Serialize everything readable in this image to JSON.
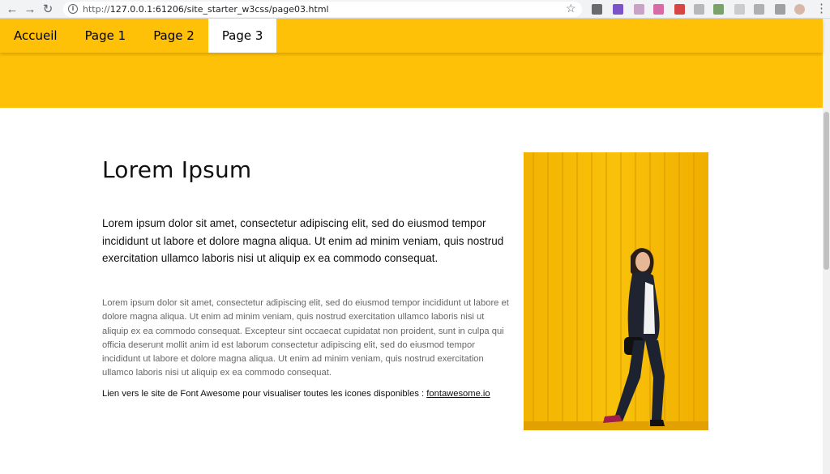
{
  "browser": {
    "url_protocol": "http://",
    "url_rest": "127.0.0.1:61206/site_starter_w3css/page03.html",
    "back_icon": "arrow-left",
    "forward_icon": "arrow-right",
    "reload_icon": "reload",
    "star_icon": "star",
    "menu_icon": "three-dots-vertical"
  },
  "nav": {
    "items": [
      {
        "label": "Accueil"
      },
      {
        "label": "Page 1"
      },
      {
        "label": "Page 2"
      },
      {
        "label": "Page 3",
        "active": true
      }
    ]
  },
  "main": {
    "title": "Lorem Ipsum",
    "lead": "Lorem ipsum dolor sit amet, consectetur adipiscing elit, sed do eiusmod tempor incididunt ut labore et dolore magna aliqua. Ut enim ad minim veniam, quis nostrud exercitation ullamco laboris nisi ut aliquip ex ea commodo consequat.",
    "body": "Lorem ipsum dolor sit amet, consectetur adipiscing elit, sed do eiusmod tempor incididunt ut labore et dolore magna aliqua. Ut enim ad minim veniam, quis nostrud exercitation ullamco laboris nisi ut aliquip ex ea commodo consequat. Excepteur sint occaecat cupidatat non proident, sunt in culpa qui officia deserunt mollit anim id est laborum consectetur adipiscing elit, sed do eiusmod tempor incididunt ut labore et dolore magna aliqua. Ut enim ad minim veniam, quis nostrud exercitation ullamco laboris nisi ut aliquip ex ea commodo consequat.",
    "link_prefix": "Lien vers le site de Font Awesome pour visualiser toutes les icones disponibles : ",
    "link_text": "fontawesome.io"
  },
  "colors": {
    "accent": "#ffc107",
    "photo_wall": "#f5b800"
  }
}
